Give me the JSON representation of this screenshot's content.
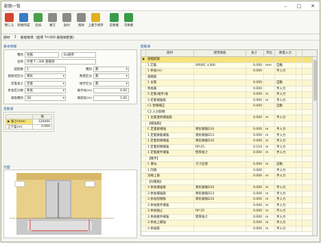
{
  "window": {
    "title": "配筋一覧",
    "min": "–",
    "max": "□",
    "close": "✕"
  },
  "toolbar": {
    "items": [
      {
        "label": "閉じる",
        "color": "#d6452f"
      },
      {
        "label": "新規作成",
        "color": "#3a7cc2"
      },
      {
        "label": "追加",
        "color": "#4aa04a"
      },
      {
        "label": "複写",
        "color": "#8a8a8a"
      },
      {
        "label": "貼付",
        "color": "#8a8a8a"
      },
      {
        "label": "削除",
        "color": "#8a8a8a"
      },
      {
        "label": "上書き保存",
        "color": "#e0b020"
      },
      {
        "label": "前要素",
        "color": "#3a9a4a"
      },
      {
        "label": "次要素",
        "color": "#3a9a4a"
      }
    ]
  },
  "subbar": {
    "a": "部材",
    "b": "1",
    "c": "基礎標準（壁厚 T=300 基礎梁配筋）"
  },
  "basic": {
    "section": "基本情報",
    "name_label": "種別",
    "name_value": "柱筋",
    "name_value2": "Dx筋単",
    "label2": "名称",
    "value2": "外壁 T=300 基礎梁",
    "f1": {
      "label": "配筋数",
      "value": "1",
      "label2": "種別",
      "value2": "無"
    },
    "f2": {
      "label": "鉄筋径区分",
      "value": "異形",
      "label2": "数量区分",
      "value2": "無"
    },
    "f3": {
      "label": "定着長さ",
      "value": "定着",
      "label2": "継手区分",
      "value2": "無"
    },
    "f4": {
      "label": "余長区分数",
      "value": "余長",
      "label2": "継手長(m)",
      "value2": "0.00"
    },
    "f5": {
      "label": "鉄筋種別",
      "value": "SD",
      "label2": "端部長(m)",
      "value2": "1.00"
    }
  },
  "param": {
    "section": "変数表",
    "head": "値",
    "rows": [
      {
        "k": "▶ 長さ(mm)",
        "v": "120000"
      },
      {
        "k": "上下差(m)",
        "v": "0.000"
      }
    ]
  },
  "diagram": {
    "section": "付図"
  },
  "grid": {
    "section": "配筋表",
    "headers": [
      "",
      "部材",
      "使用鉄筋",
      "長さ",
      "単位",
      "数量入力",
      ""
    ],
    "rows": [
      [
        "▶",
        "基礎配筋",
        "",
        "",
        "",
        "",
        ""
      ],
      [
        "",
        "1 芯筋",
        "VRI/RC ×300",
        "0.000",
        "mm",
        "自動",
        ""
      ],
      [
        "",
        "1 余長(m)",
        "",
        "0.000",
        "",
        "手入力",
        ""
      ],
      [
        "",
        "基礎筋",
        "",
        "",
        "",
        "",
        ""
      ],
      [
        "",
        "1 主筋",
        "",
        "0.000",
        "",
        "自動",
        ""
      ],
      [
        "",
        "余長筋",
        "",
        "0.000",
        "",
        "手入力",
        ""
      ],
      [
        "",
        "5 定着(継手)長",
        "",
        "0.000",
        "m",
        "手入力",
        ""
      ],
      [
        "",
        "3 定着補強筋",
        "",
        "0.000",
        "m",
        "手入力",
        ""
      ],
      [
        "",
        "C1 割増補正",
        "",
        "0.000",
        "",
        "自動",
        ""
      ],
      [
        "",
        "C2 入力割増",
        "",
        "",
        "",
        "",
        ""
      ],
      [
        "",
        "1 主筋連続補強筋",
        "",
        "0.000",
        "m",
        "手入力",
        ""
      ],
      [
        "",
        "【補強筋】",
        "",
        "",
        "",
        "",
        ""
      ],
      [
        "",
        "C 定着部補強",
        "異形鉄筋D10",
        "0.000",
        "m",
        "手入力",
        ""
      ],
      [
        "",
        "1 定着鉄筋補強",
        "異形鉄筋D13",
        "0.000",
        "m",
        "手入力",
        ""
      ],
      [
        "",
        "1 定着割増補強",
        "異形鉄筋D10",
        "0.000",
        "m",
        "手入力",
        ""
      ],
      [
        "",
        "1 定着割増補強",
        "RP-25",
        "0.110",
        "m",
        "手入力",
        ""
      ],
      [
        "",
        "1 定着継手補強",
        "壁厚長さ",
        "0.000",
        "m",
        "手入力",
        ""
      ],
      [
        "",
        "【継手】",
        "",
        "",
        "",
        "",
        ""
      ],
      [
        "",
        "C 重ね",
        "ガス圧接",
        "0.000",
        "m",
        "自動",
        ""
      ],
      [
        "",
        "1 内側",
        "",
        "0.000",
        "",
        "手入力",
        ""
      ],
      [
        "",
        "流線上筋",
        "",
        "0.000",
        "m",
        "手入力",
        ""
      ],
      [
        "",
        "【付属筋】",
        "",
        "",
        "",
        "",
        ""
      ],
      [
        "",
        "3 余長補強筋",
        "異形鉄筋D10",
        "0.000",
        "m",
        "手入力",
        ""
      ],
      [
        "",
        "3 余長補強筋",
        "異形鉄筋D13",
        "0.000",
        "m",
        "手入力",
        ""
      ],
      [
        "",
        "3 余長割増筋",
        "異形鉄筋D10",
        "0.000",
        "m",
        "手入力",
        ""
      ],
      [
        "",
        "3 余長継手補強",
        "",
        "0.000",
        "m",
        "手入力",
        ""
      ],
      [
        "",
        "3 余長幅止",
        "RP-25",
        "0.000",
        "m",
        "手入力",
        ""
      ],
      [
        "",
        "3 余長継手補強",
        "壁厚長さ",
        "0.000",
        "m",
        "手入力",
        ""
      ],
      [
        "",
        "3 余長上補強",
        "",
        "0.000",
        "m",
        "手入力",
        ""
      ],
      [
        "",
        "3 余長筋",
        "",
        "0.000",
        "m",
        "手入力",
        ""
      ]
    ]
  }
}
